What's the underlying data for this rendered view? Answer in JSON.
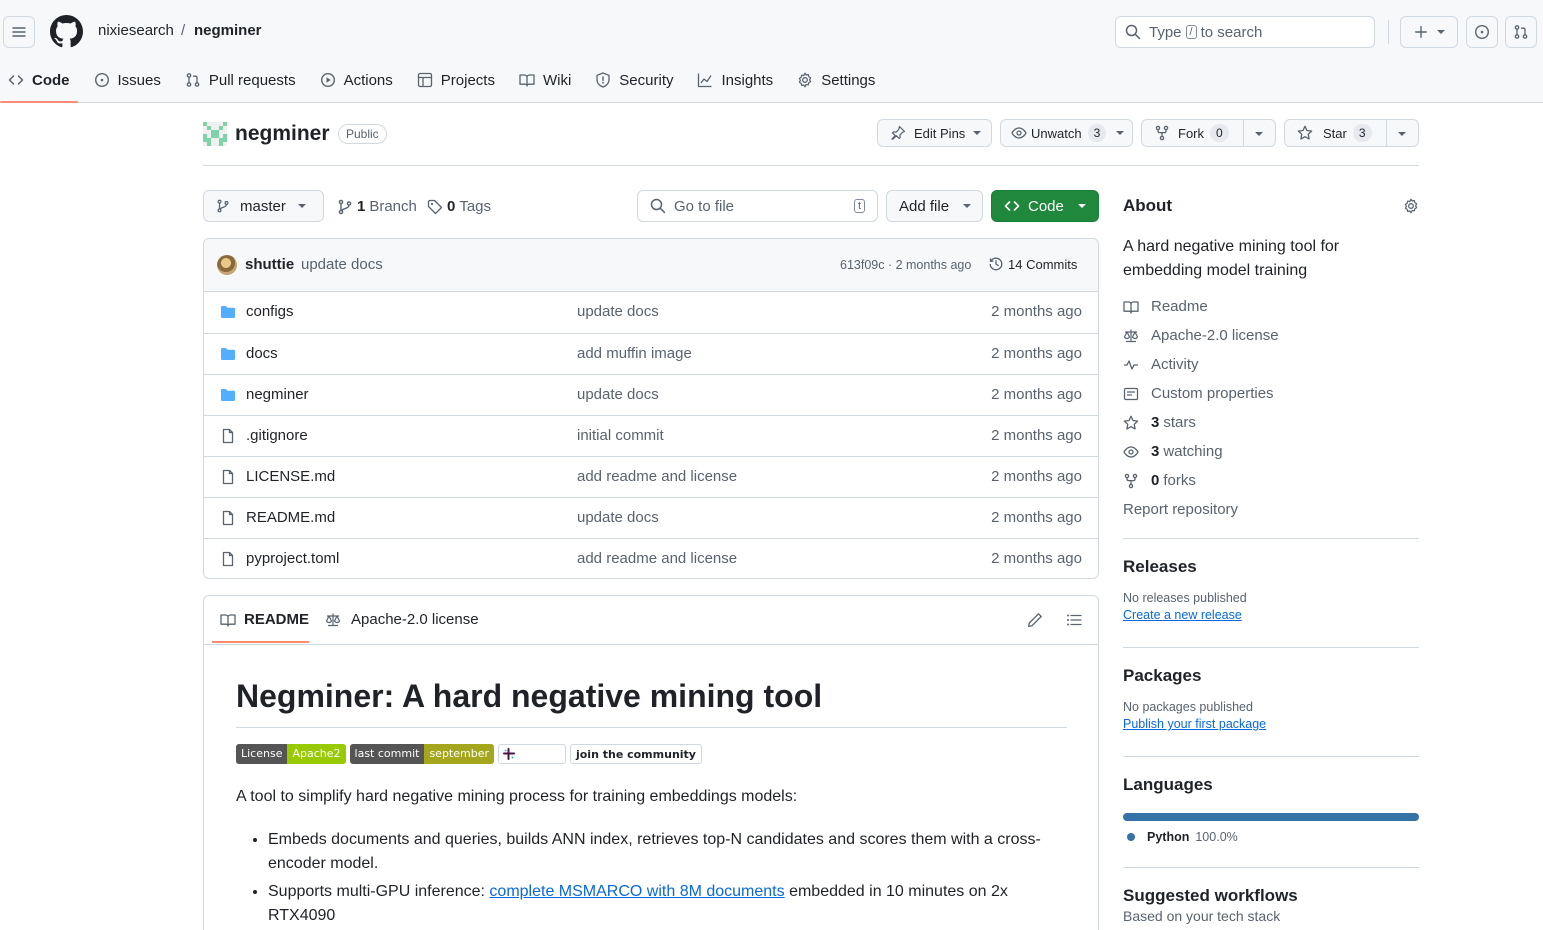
{
  "header": {
    "owner": "nixiesearch",
    "separator": "/",
    "repo": "negminer",
    "search_prefix": "Type",
    "search_key": "/",
    "search_suffix": "to search"
  },
  "tabs": [
    {
      "label": "Code",
      "icon": "code-icon",
      "active": true
    },
    {
      "label": "Issues",
      "icon": "issue-icon"
    },
    {
      "label": "Pull requests",
      "icon": "pull-request-icon"
    },
    {
      "label": "Actions",
      "icon": "play-icon"
    },
    {
      "label": "Projects",
      "icon": "table-icon"
    },
    {
      "label": "Wiki",
      "icon": "book-icon"
    },
    {
      "label": "Security",
      "icon": "shield-icon"
    },
    {
      "label": "Insights",
      "icon": "graph-icon"
    },
    {
      "label": "Settings",
      "icon": "gear-icon"
    }
  ],
  "repo": {
    "name": "negminer",
    "visibility": "Public",
    "edit_pins": "Edit Pins",
    "unwatch": "Unwatch",
    "watch_count": "3",
    "fork": "Fork",
    "fork_count": "0",
    "star": "Star",
    "star_count": "3"
  },
  "toolbar": {
    "branch": "master",
    "branch_count": "1",
    "branch_label": "Branch",
    "tag_count": "0",
    "tag_label": "Tags",
    "goto_placeholder": "Go to file",
    "goto_key": "t",
    "add_file": "Add file",
    "code": "Code"
  },
  "commit": {
    "author": "shuttie",
    "message": "update docs",
    "hash_time": "613f09c · 2 months ago",
    "commits": "14 Commits"
  },
  "files": [
    {
      "name": "configs",
      "type": "dir",
      "message": "update docs",
      "age": "2 months ago"
    },
    {
      "name": "docs",
      "type": "dir",
      "message": "add muffin image",
      "age": "2 months ago"
    },
    {
      "name": "negminer",
      "type": "dir",
      "message": "update docs",
      "age": "2 months ago"
    },
    {
      "name": ".gitignore",
      "type": "file",
      "message": "initial commit",
      "age": "2 months ago"
    },
    {
      "name": "LICENSE.md",
      "type": "file",
      "message": "add readme and license",
      "age": "2 months ago"
    },
    {
      "name": "README.md",
      "type": "file",
      "message": "update docs",
      "age": "2 months ago"
    },
    {
      "name": "pyproject.toml",
      "type": "file",
      "message": "add readme and license",
      "age": "2 months ago"
    }
  ],
  "readme": {
    "tab_readme": "README",
    "tab_license": "Apache-2.0 license",
    "title": "Negminer: A hard negative mining tool",
    "badges": {
      "license_l": "License",
      "license_r": "Apache2",
      "commit_l": "last commit",
      "commit_r": "september",
      "slack": "Slack",
      "join": "join the community"
    },
    "intro": "A tool to simplify hard negative mining process for training embeddings models:",
    "bullet1": "Embeds documents and queries, builds ANN index, retrieves top-N candidates and scores them with a cross-encoder model.",
    "bullet2_pre": "Supports multi-GPU inference: ",
    "bullet2_link": "complete MSMARCO with 8M documents",
    "bullet2_post": " embedded in 10 minutes on 2x RTX4090"
  },
  "about": {
    "title": "About",
    "description": "A hard negative mining tool for embedding model training",
    "readme": "Readme",
    "license": "Apache-2.0 license",
    "activity": "Activity",
    "custom_props": "Custom properties",
    "stars_n": "3",
    "stars": "stars",
    "watching_n": "3",
    "watching": "watching",
    "forks_n": "0",
    "forks": "forks",
    "report": "Report repository"
  },
  "releases": {
    "title": "Releases",
    "none": "No releases published",
    "link": "Create a new release"
  },
  "packages": {
    "title": "Packages",
    "none": "No packages published",
    "link": "Publish your first package"
  },
  "languages": {
    "title": "Languages",
    "name": "Python",
    "pct": "100.0%",
    "fraction": 1.0,
    "color": "#3572A5"
  },
  "workflows": {
    "title": "Suggested workflows",
    "subtitle": "Based on your tech stack"
  }
}
